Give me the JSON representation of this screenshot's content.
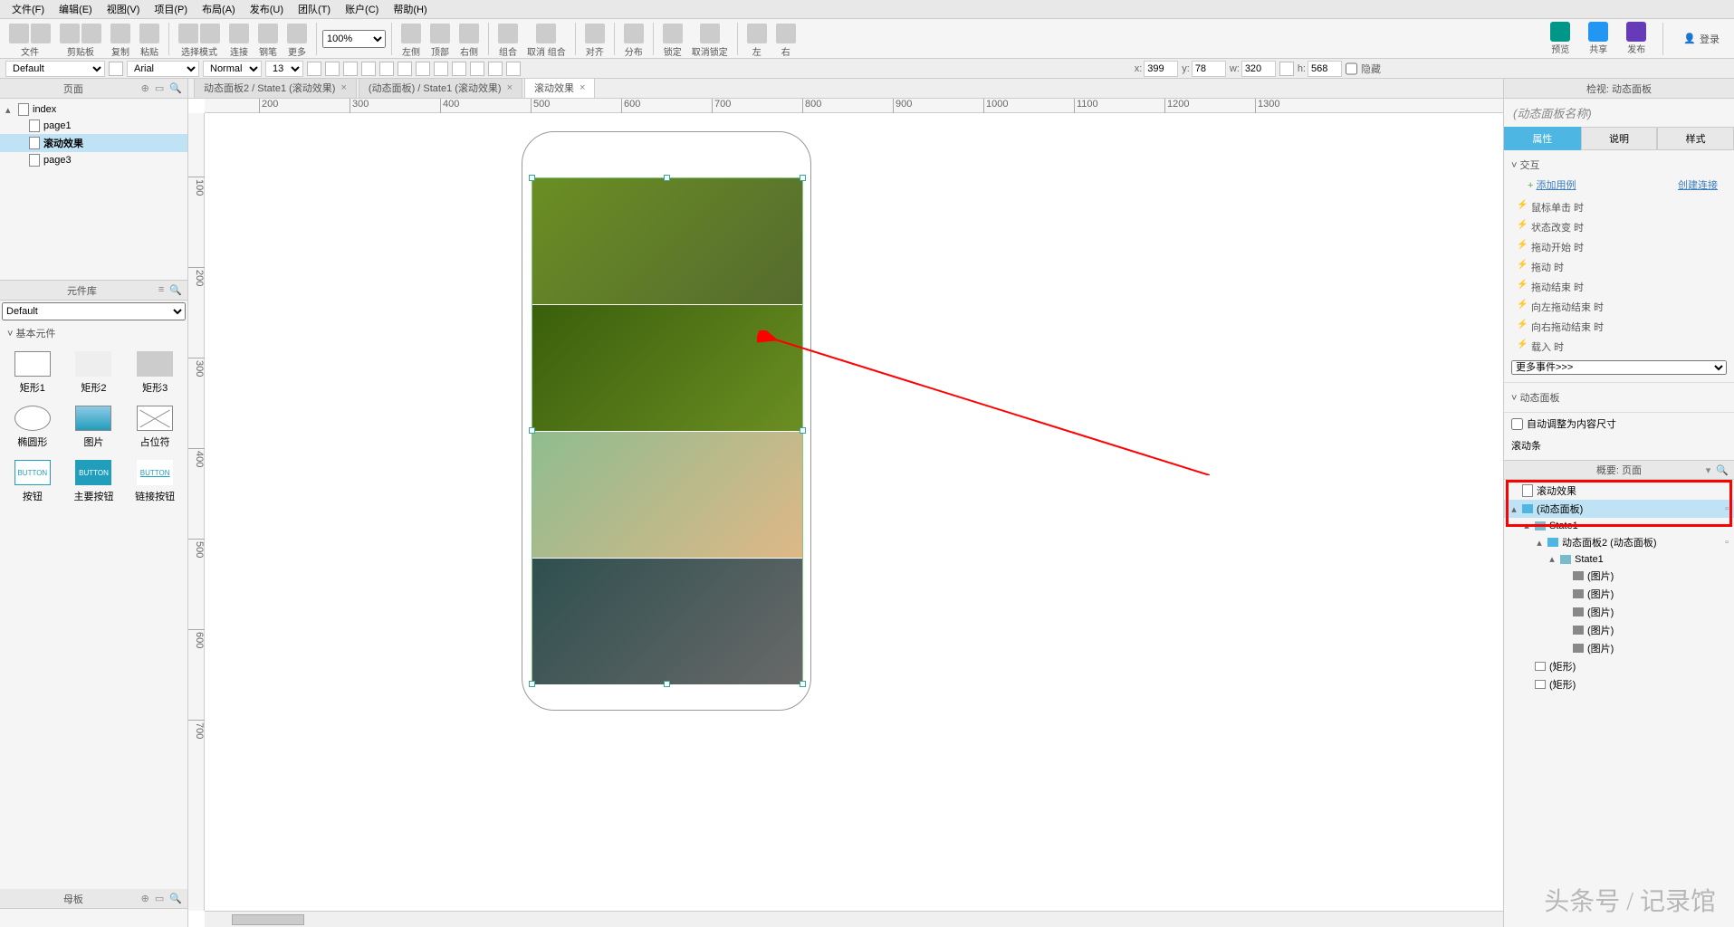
{
  "menu": [
    "文件(F)",
    "编辑(E)",
    "视图(V)",
    "项目(P)",
    "布局(A)",
    "发布(U)",
    "团队(T)",
    "账户(C)",
    "帮助(H)"
  ],
  "toolbar": {
    "file_label": "文件",
    "clipboard_label": "剪贴板",
    "copy_label": "复制",
    "paste_label": "粘贴",
    "select_label": "选择模式",
    "connect_label": "连接",
    "pen_label": "钢笔",
    "more_label": "更多",
    "zoom": "100%",
    "left_label": "左侧",
    "top_label": "顶部",
    "right_label": "右侧",
    "group_label": "组合",
    "ungroup_label": "取消 组合",
    "align_label": "对齐",
    "distribute_label": "分布",
    "lock_label": "锁定",
    "unlock_label": "取消锁定",
    "l": "左",
    "r": "右",
    "preview": "预览",
    "share": "共享",
    "publish": "发布",
    "login": "登录"
  },
  "stylebar": {
    "style_default": "Default",
    "font_default": "Arial",
    "weight": "Normal",
    "size": "13",
    "x_label": "x:",
    "x": "399",
    "y_label": "y:",
    "y": "78",
    "w_label": "w:",
    "w": "320",
    "h_label": "h:",
    "h": "568",
    "hidden": "隐藏"
  },
  "left": {
    "pages_title": "页面",
    "tree": {
      "root": "index",
      "p1": "page1",
      "p2": "滚动效果",
      "p3": "page3"
    },
    "lib_title": "元件库",
    "lib_default": "Default",
    "lib_cat": "基本元件",
    "widgets": [
      "矩形1",
      "矩形2",
      "矩形3",
      "椭圆形",
      "图片",
      "占位符",
      "按钮",
      "主要按钮",
      "链接按钮"
    ],
    "masters_title": "母板"
  },
  "tabs": {
    "t1": "动态面板2 / State1 (滚动效果)",
    "t2": "(动态面板) / State1 (滚动效果)",
    "t3": "滚动效果"
  },
  "right": {
    "inspect_title": "检视: 动态面板",
    "dp_name": "(动态面板名称)",
    "tab_prop": "属性",
    "tab_note": "说明",
    "tab_style": "样式",
    "sec_interact": "交互",
    "add_case": "添加用例",
    "create_link": "创建连接",
    "events": [
      "鼠标单击 时",
      "状态改变 时",
      "拖动开始 时",
      "拖动 时",
      "拖动结束 时",
      "向左拖动结束 时",
      "向右拖动结束 时",
      "载入 时"
    ],
    "more_events": "更多事件>>>",
    "sec_dp": "动态面板",
    "fit": "自动调整为内容尺寸",
    "scrollbar": "滚动条",
    "outline_title": "概要: 页面",
    "outline": {
      "root": "滚动效果",
      "dp": "(动态面板)",
      "s1": "State1",
      "dp2": "动态面板2 (动态面板)",
      "s1b": "State1",
      "img": "(图片)",
      "rect": "(矩形)"
    }
  },
  "ruler_ticks": [
    200,
    300,
    400,
    500,
    600,
    700,
    800,
    900,
    1000,
    1100,
    1200,
    1300
  ],
  "ruler_ticks_v": [
    100,
    200,
    300,
    400,
    500,
    600,
    700
  ],
  "watermark": "头条号 / 记录馆"
}
